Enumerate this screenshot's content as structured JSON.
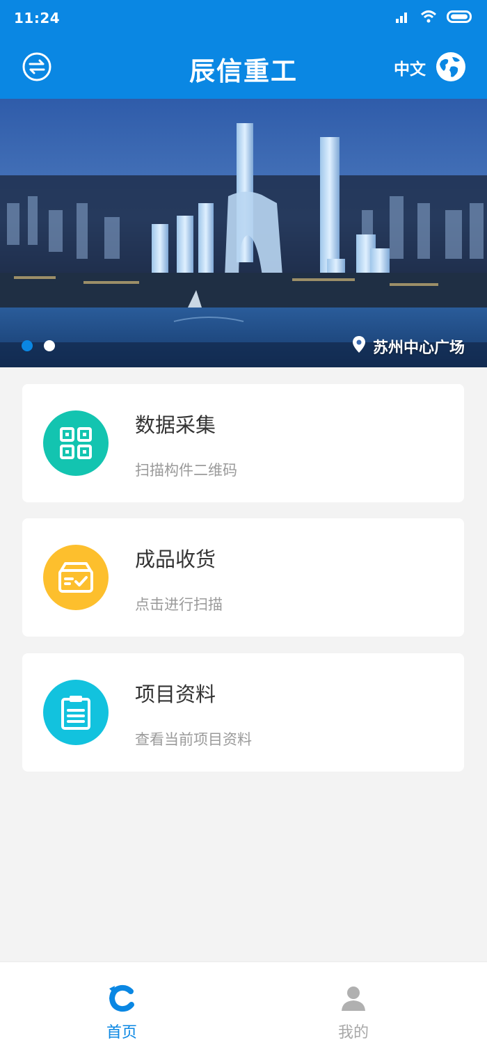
{
  "status_bar": {
    "time": "11:24",
    "icons": [
      "signal-icon",
      "wifi-icon",
      "battery-icon"
    ]
  },
  "header": {
    "title": "辰信重工",
    "language": "中文",
    "left_icon": "switch-icon",
    "right_icon": "globe-icon",
    "background": "#0a87e3"
  },
  "banner": {
    "location": "苏州中心广场",
    "slides": 2,
    "active_slide": 1
  },
  "cards": [
    {
      "title": "数据采集",
      "subtitle": "扫描构件二维码",
      "icon": "qr-code-icon",
      "color": "#13c4b0"
    },
    {
      "title": "成品收货",
      "subtitle": "点击进行扫描",
      "icon": "package-check-icon",
      "color": "#fdbf2d"
    },
    {
      "title": "项目资料",
      "subtitle": "查看当前项目资料",
      "icon": "clipboard-icon",
      "color": "#12c2de"
    }
  ],
  "tabbar": {
    "items": [
      {
        "label": "首页",
        "icon": "home-logo-icon",
        "active": true,
        "color": "#0a87e3"
      },
      {
        "label": "我的",
        "icon": "user-icon",
        "active": false,
        "color": "#b0b0b0"
      }
    ]
  }
}
